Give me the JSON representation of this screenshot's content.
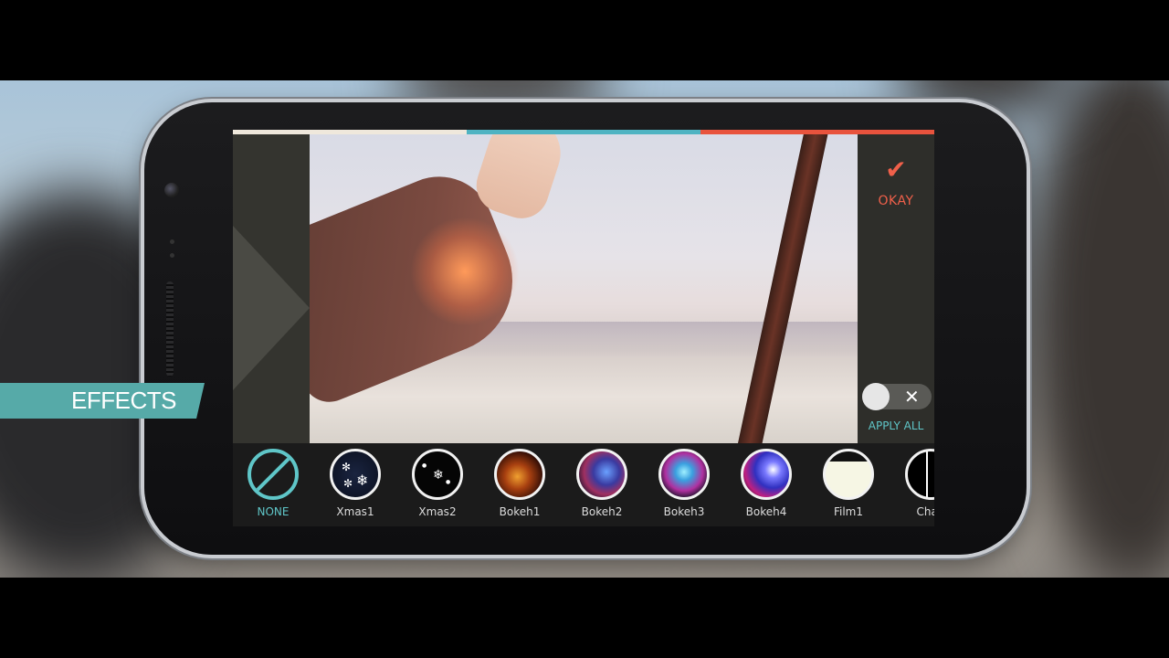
{
  "overlay": {
    "title": "EFFECTS",
    "accent": "#56aaa8"
  },
  "progress": {
    "colors": [
      "#efe8dc",
      "#4fb3c2",
      "#e8533d"
    ]
  },
  "okay": {
    "label": "OKAY",
    "icon": "checkmark-icon",
    "color": "#f0604a"
  },
  "apply_all": {
    "label": "APPLY ALL",
    "toggle": "off",
    "icon": "close-icon",
    "color": "#5fc6c8"
  },
  "effects": [
    {
      "label": "NONE",
      "selected": true,
      "icon": "none-icon"
    },
    {
      "label": "Xmas1",
      "selected": false
    },
    {
      "label": "Xmas2",
      "selected": false
    },
    {
      "label": "Bokeh1",
      "selected": false
    },
    {
      "label": "Bokeh2",
      "selected": false
    },
    {
      "label": "Bokeh3",
      "selected": false
    },
    {
      "label": "Bokeh4",
      "selected": false
    },
    {
      "label": "Film1",
      "selected": false
    },
    {
      "label": "Chan",
      "selected": false
    }
  ]
}
